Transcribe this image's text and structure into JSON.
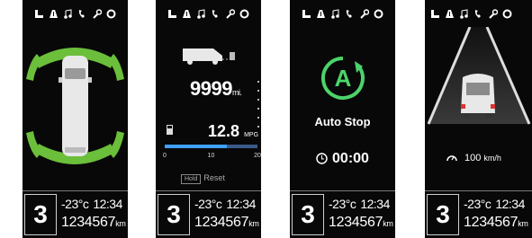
{
  "accent_green": "#6bbf3a",
  "accent_blue": "#3fa0ff",
  "top_icons": [
    "seat-icon",
    "road-icon",
    "music-icon",
    "phone-icon",
    "wrench-icon",
    "gear-icon"
  ],
  "status_bar": {
    "gear": "3",
    "temperature": "-23",
    "temperature_unit": "°c",
    "time": "12:34",
    "odometer": "1234567",
    "odometer_unit": "km"
  },
  "trip": {
    "distance_value": "9999",
    "distance_unit": "mi.",
    "fuel_value": "12.8",
    "fuel_unit": "MPG",
    "gauge_ticks": [
      "0",
      "10",
      "20"
    ],
    "gauge_fraction": 0.67,
    "hold_label": "Hold",
    "reset_label": "Reset"
  },
  "auto_stop": {
    "label": "Auto Stop",
    "timer": "00:00"
  },
  "cruise": {
    "speed_value": "100",
    "speed_unit": "km/h"
  }
}
